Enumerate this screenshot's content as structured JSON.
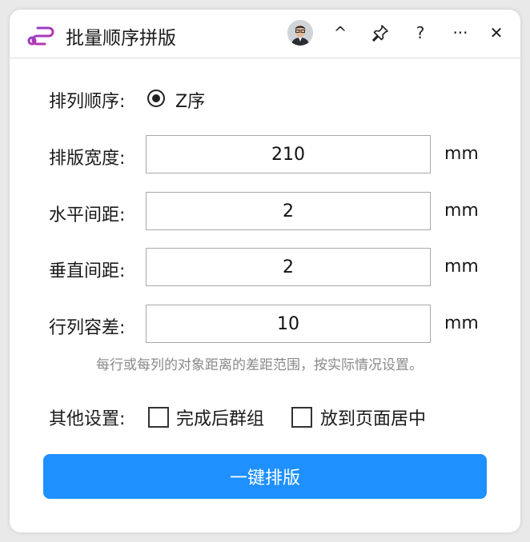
{
  "window": {
    "title": "批量顺序拼版",
    "app_icon": "layout-nodes-icon",
    "controls": {
      "collapse": "^",
      "pin": "pin-icon",
      "help": "?",
      "more": "···",
      "close": "✕"
    }
  },
  "form": {
    "order": {
      "label": "排列顺序:",
      "option_label": "Z序",
      "selected": true
    },
    "width": {
      "label": "排版宽度:",
      "value": "210",
      "unit": "mm"
    },
    "h_spacing": {
      "label": "水平间距:",
      "value": "2",
      "unit": "mm"
    },
    "v_spacing": {
      "label": "垂直间距:",
      "value": "2",
      "unit": "mm"
    },
    "tolerance": {
      "label": "行列容差:",
      "value": "10",
      "unit": "mm",
      "hint": "每行或每列的对象距离的差距范围，按实际情况设置。"
    },
    "other": {
      "label": "其他设置:",
      "group_label": "完成后群组",
      "group_checked": false,
      "center_label": "放到页面居中",
      "center_checked": false
    }
  },
  "action": {
    "label": "一键排版"
  },
  "colors": {
    "accent": "#1e90ff",
    "icon_purple": "#8a3fd1",
    "icon_magenta": "#c8359e"
  }
}
